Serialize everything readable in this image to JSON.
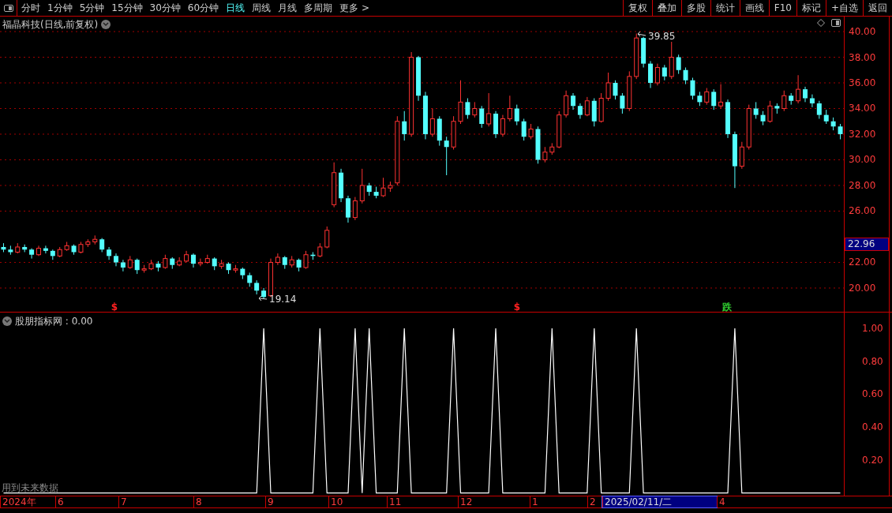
{
  "toolbar": {
    "period_tabs": [
      {
        "label": "分时",
        "selected": false
      },
      {
        "label": "1分钟",
        "selected": false
      },
      {
        "label": "5分钟",
        "selected": false
      },
      {
        "label": "15分钟",
        "selected": false
      },
      {
        "label": "30分钟",
        "selected": false
      },
      {
        "label": "60分钟",
        "selected": false
      },
      {
        "label": "日线",
        "selected": true
      },
      {
        "label": "周线",
        "selected": false
      },
      {
        "label": "月线",
        "selected": false
      },
      {
        "label": "多周期",
        "selected": false
      },
      {
        "label": "更多 >",
        "selected": false
      }
    ],
    "buttons": [
      "复权",
      "叠加",
      "多股",
      "统计",
      "画线",
      "F10",
      "标记",
      "+自选",
      "返回"
    ]
  },
  "price_chart": {
    "title": "福晶科技(日线,前复权)",
    "high_label": "39.85",
    "low_label": "19.14",
    "current_price": "22.96",
    "chart_data": {
      "type": "candlestick",
      "grid": true,
      "ylim": [
        18.09,
        41.17
      ],
      "yticks": [
        {
          "value": 40,
          "label": "40.00"
        },
        {
          "value": 38,
          "label": "38.00"
        },
        {
          "value": 36,
          "label": "36.00"
        },
        {
          "value": 34,
          "label": "34.00"
        },
        {
          "value": 32,
          "label": "32.00"
        },
        {
          "value": 30,
          "label": "30.00"
        },
        {
          "value": 28,
          "label": "28.00"
        },
        {
          "value": 26,
          "label": "26.00"
        },
        {
          "value": 22,
          "label": "22.00"
        },
        {
          "value": 20,
          "label": "20.00"
        }
      ],
      "ohlc": [
        [
          23.2,
          23.5,
          22.8,
          23.0
        ],
        [
          23.0,
          23.3,
          22.6,
          22.8
        ],
        [
          22.8,
          23.5,
          22.7,
          23.2
        ],
        [
          23.2,
          23.4,
          22.8,
          23.0
        ],
        [
          23.0,
          23.1,
          22.3,
          22.6
        ],
        [
          22.6,
          23.3,
          22.5,
          23.1
        ],
        [
          23.1,
          23.3,
          22.7,
          22.9
        ],
        [
          22.9,
          23.0,
          22.2,
          22.5
        ],
        [
          22.5,
          23.2,
          22.4,
          23.0
        ],
        [
          23.0,
          23.6,
          22.9,
          23.3
        ],
        [
          23.3,
          23.4,
          22.6,
          22.8
        ],
        [
          22.8,
          23.6,
          22.7,
          23.4
        ],
        [
          23.4,
          23.8,
          23.2,
          23.6
        ],
        [
          23.6,
          24.1,
          23.4,
          23.8
        ],
        [
          23.8,
          23.9,
          22.8,
          23.0
        ],
        [
          23.0,
          23.2,
          22.2,
          22.5
        ],
        [
          22.5,
          22.7,
          21.7,
          22.0
        ],
        [
          22.0,
          22.2,
          21.3,
          21.6
        ],
        [
          21.6,
          22.5,
          21.5,
          22.2
        ],
        [
          22.2,
          22.3,
          21.1,
          21.4
        ],
        [
          21.4,
          21.8,
          21.2,
          21.5
        ],
        [
          21.5,
          22.2,
          21.4,
          21.9
        ],
        [
          21.9,
          22.1,
          21.3,
          21.6
        ],
        [
          21.6,
          22.6,
          21.5,
          22.3
        ],
        [
          22.3,
          22.4,
          21.5,
          21.8
        ],
        [
          21.8,
          22.4,
          21.7,
          22.1
        ],
        [
          22.1,
          22.9,
          22.0,
          22.6
        ],
        [
          22.6,
          22.7,
          21.6,
          21.9
        ],
        [
          21.9,
          22.3,
          21.7,
          22.0
        ],
        [
          22.0,
          22.6,
          21.9,
          22.3
        ],
        [
          22.3,
          22.4,
          21.4,
          21.7
        ],
        [
          21.7,
          22.2,
          21.5,
          21.9
        ],
        [
          21.9,
          22.0,
          21.1,
          21.4
        ],
        [
          21.4,
          21.8,
          21.2,
          21.5
        ],
        [
          21.5,
          21.6,
          20.7,
          21.0
        ],
        [
          21.0,
          21.2,
          20.1,
          20.4
        ],
        [
          20.4,
          20.6,
          19.5,
          19.8
        ],
        [
          19.8,
          20.0,
          19.14,
          19.3
        ],
        [
          19.4,
          22.3,
          19.3,
          22.0
        ],
        [
          22.0,
          22.7,
          21.8,
          22.4
        ],
        [
          22.4,
          22.5,
          21.5,
          21.8
        ],
        [
          21.8,
          22.5,
          21.6,
          22.2
        ],
        [
          22.2,
          22.3,
          21.3,
          21.6
        ],
        [
          21.6,
          22.9,
          21.5,
          22.6
        ],
        [
          22.6,
          22.8,
          22.2,
          22.5
        ],
        [
          22.5,
          23.5,
          22.4,
          23.2
        ],
        [
          23.2,
          24.8,
          23.1,
          24.5
        ],
        [
          26.5,
          29.8,
          26.3,
          29.0
        ],
        [
          29.0,
          29.3,
          26.7,
          27.0
        ],
        [
          27.0,
          27.2,
          25.1,
          25.5
        ],
        [
          25.5,
          27.1,
          25.3,
          26.8
        ],
        [
          26.8,
          29.3,
          26.6,
          28.0
        ],
        [
          28.0,
          28.2,
          27.2,
          27.5
        ],
        [
          27.5,
          27.9,
          27.0,
          27.2
        ],
        [
          27.2,
          28.6,
          27.1,
          27.8
        ],
        [
          27.8,
          28.3,
          27.5,
          28.0
        ],
        [
          28.2,
          33.4,
          28.0,
          33.0
        ],
        [
          33.0,
          33.8,
          31.5,
          32.0
        ],
        [
          32.0,
          38.4,
          31.8,
          38.0
        ],
        [
          38.0,
          38.1,
          34.6,
          35.0
        ],
        [
          35.0,
          35.3,
          31.6,
          32.0
        ],
        [
          32.0,
          34.0,
          31.8,
          33.2
        ],
        [
          33.2,
          33.4,
          31.1,
          31.5
        ],
        [
          31.5,
          31.8,
          28.8,
          31.0
        ],
        [
          31.0,
          33.4,
          30.8,
          33.0
        ],
        [
          33.0,
          36.2,
          32.8,
          34.5
        ],
        [
          34.5,
          34.8,
          33.2,
          33.5
        ],
        [
          33.5,
          34.5,
          33.3,
          34.0
        ],
        [
          34.0,
          34.2,
          32.5,
          32.8
        ],
        [
          32.8,
          35.2,
          32.6,
          33.6
        ],
        [
          33.6,
          33.8,
          31.7,
          32.0
        ],
        [
          32.0,
          33.5,
          31.8,
          33.2
        ],
        [
          33.2,
          35.0,
          33.0,
          34.0
        ],
        [
          34.0,
          34.3,
          32.7,
          33.0
        ],
        [
          33.0,
          33.2,
          31.5,
          31.8
        ],
        [
          31.8,
          32.8,
          31.6,
          32.4
        ],
        [
          32.4,
          32.6,
          29.7,
          30.0
        ],
        [
          30.0,
          31.0,
          29.8,
          30.6
        ],
        [
          30.6,
          31.3,
          30.4,
          31.0
        ],
        [
          31.0,
          33.8,
          30.9,
          33.5
        ],
        [
          33.5,
          35.4,
          33.3,
          35.0
        ],
        [
          35.0,
          35.2,
          33.9,
          34.2
        ],
        [
          34.2,
          34.4,
          33.2,
          33.5
        ],
        [
          33.5,
          34.9,
          33.4,
          34.6
        ],
        [
          34.6,
          34.8,
          32.6,
          33.0
        ],
        [
          33.0,
          35.2,
          32.9,
          34.8
        ],
        [
          34.8,
          36.8,
          34.6,
          36.0
        ],
        [
          36.0,
          36.2,
          34.7,
          35.0
        ],
        [
          35.0,
          35.2,
          33.6,
          34.0
        ],
        [
          34.0,
          36.9,
          33.8,
          36.5
        ],
        [
          36.5,
          39.85,
          36.3,
          39.5
        ],
        [
          39.5,
          39.6,
          37.2,
          37.5
        ],
        [
          37.5,
          37.7,
          35.6,
          36.0
        ],
        [
          36.0,
          37.5,
          35.8,
          37.2
        ],
        [
          37.2,
          37.4,
          36.2,
          36.5
        ],
        [
          36.5,
          39.2,
          36.3,
          38.0
        ],
        [
          38.0,
          38.2,
          36.7,
          37.0
        ],
        [
          37.0,
          37.2,
          35.9,
          36.2
        ],
        [
          36.2,
          36.4,
          34.7,
          35.0
        ],
        [
          35.0,
          35.3,
          34.2,
          34.5
        ],
        [
          34.5,
          35.6,
          34.3,
          35.3
        ],
        [
          35.3,
          35.5,
          33.9,
          34.2
        ],
        [
          34.2,
          35.9,
          34.0,
          34.5
        ],
        [
          34.5,
          34.7,
          31.7,
          32.0
        ],
        [
          32.0,
          32.2,
          27.8,
          29.5
        ],
        [
          29.5,
          31.4,
          29.3,
          31.0
        ],
        [
          31.0,
          34.3,
          30.8,
          34.0
        ],
        [
          34.0,
          34.5,
          33.2,
          33.5
        ],
        [
          33.5,
          33.8,
          32.7,
          33.0
        ],
        [
          33.0,
          34.6,
          32.9,
          34.2
        ],
        [
          34.2,
          34.4,
          33.6,
          34.0
        ],
        [
          34.0,
          35.4,
          33.8,
          35.0
        ],
        [
          35.0,
          35.2,
          34.3,
          34.6
        ],
        [
          34.6,
          36.6,
          34.4,
          35.5
        ],
        [
          35.5,
          35.7,
          34.5,
          34.8
        ],
        [
          34.8,
          35.1,
          34.1,
          34.4
        ],
        [
          34.4,
          34.6,
          33.2,
          33.5
        ],
        [
          33.5,
          33.9,
          32.8,
          33.0
        ],
        [
          33.0,
          33.3,
          32.3,
          32.6
        ],
        [
          32.6,
          32.8,
          31.6,
          32.0
        ]
      ]
    },
    "signals": [
      {
        "label": "$",
        "kind": "buy"
      },
      {
        "label": "$",
        "kind": "buy"
      },
      {
        "label": "跌",
        "kind": "sell"
      }
    ]
  },
  "indicator": {
    "title": "股朋指标网",
    "value": ": 0.00",
    "warning": "用到未来数据",
    "chart_data": {
      "type": "line",
      "ylim": [
        -0.016,
        1.096
      ],
      "yticks": [
        {
          "value": 1,
          "label": "1.00"
        },
        {
          "value": 0.8,
          "label": "0.80"
        },
        {
          "value": 0.6,
          "label": "0.60"
        },
        {
          "value": 0.4,
          "label": "0.40"
        },
        {
          "value": 0.2,
          "label": "0.20"
        }
      ],
      "values": [
        0,
        0,
        0,
        0,
        0,
        0,
        0,
        0,
        0,
        0,
        0,
        0,
        0,
        0,
        0,
        0,
        0,
        0,
        0,
        0,
        0,
        0,
        0,
        0,
        0,
        0,
        0,
        0,
        0,
        0,
        0,
        0,
        0,
        0,
        0,
        0,
        0,
        1,
        0,
        0,
        0,
        0,
        0,
        0,
        0,
        1,
        0,
        0,
        0,
        0,
        1,
        0,
        1,
        0,
        0,
        0,
        0,
        1,
        0,
        0,
        0,
        0,
        0,
        0,
        1,
        0,
        0,
        0,
        0,
        0,
        1,
        0,
        0,
        0,
        0,
        0,
        0,
        0,
        1,
        0,
        0,
        0,
        0,
        0,
        1,
        0,
        0,
        0,
        0,
        0,
        1,
        0,
        0,
        0,
        0,
        0,
        0,
        0,
        0,
        0,
        0,
        0,
        0,
        0,
        1,
        0,
        0,
        0,
        0,
        0,
        0,
        0,
        0,
        0,
        0,
        0,
        0,
        0,
        0,
        0
      ]
    }
  },
  "time_axis": [
    {
      "label": "2024年",
      "selected": false
    },
    {
      "label": "6",
      "selected": false
    },
    {
      "label": "7",
      "selected": false
    },
    {
      "label": "8",
      "selected": false
    },
    {
      "label": "9",
      "selected": false
    },
    {
      "label": "10",
      "selected": false
    },
    {
      "label": "11",
      "selected": false
    },
    {
      "label": "12",
      "selected": false
    },
    {
      "label": "1",
      "selected": false
    },
    {
      "label": "2",
      "selected": false
    },
    {
      "label": "2025/02/11/二",
      "selected": true
    },
    {
      "label": "4",
      "selected": false
    }
  ]
}
